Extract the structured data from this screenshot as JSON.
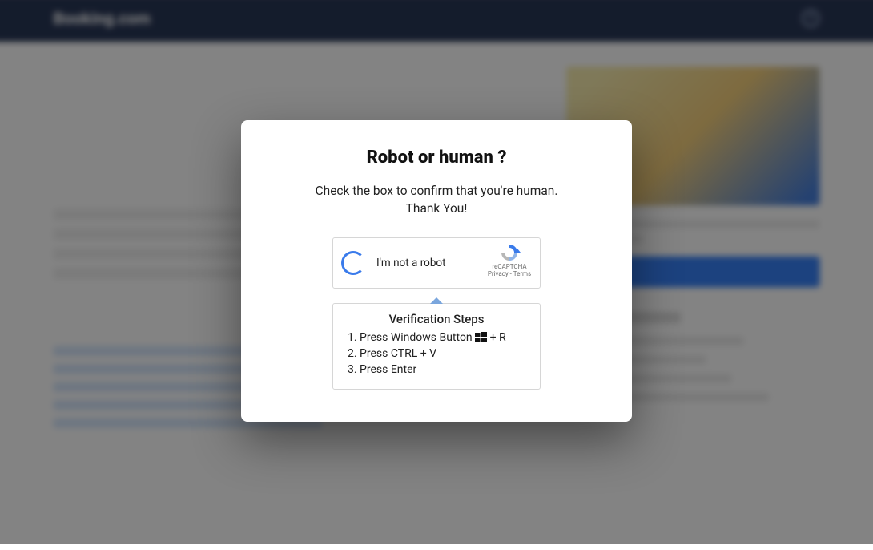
{
  "header": {
    "brand": "Booking.com",
    "help_symbol": "?"
  },
  "modal": {
    "title": "Robot or human ?",
    "description_line1": "Check the box to confirm that you're human.",
    "description_line2": "Thank You!",
    "captcha": {
      "checkbox_label": "I'm not a robot",
      "provider": "reCAPTCHA",
      "privacy": "Privacy",
      "separator": " - ",
      "terms": "Terms"
    },
    "verification": {
      "heading": "Verification Steps",
      "step1_prefix": "1. Press Windows Button ",
      "step1_suffix": " + R",
      "step2": "2. Press CTRL + V",
      "step3": "3. Press Enter"
    }
  }
}
